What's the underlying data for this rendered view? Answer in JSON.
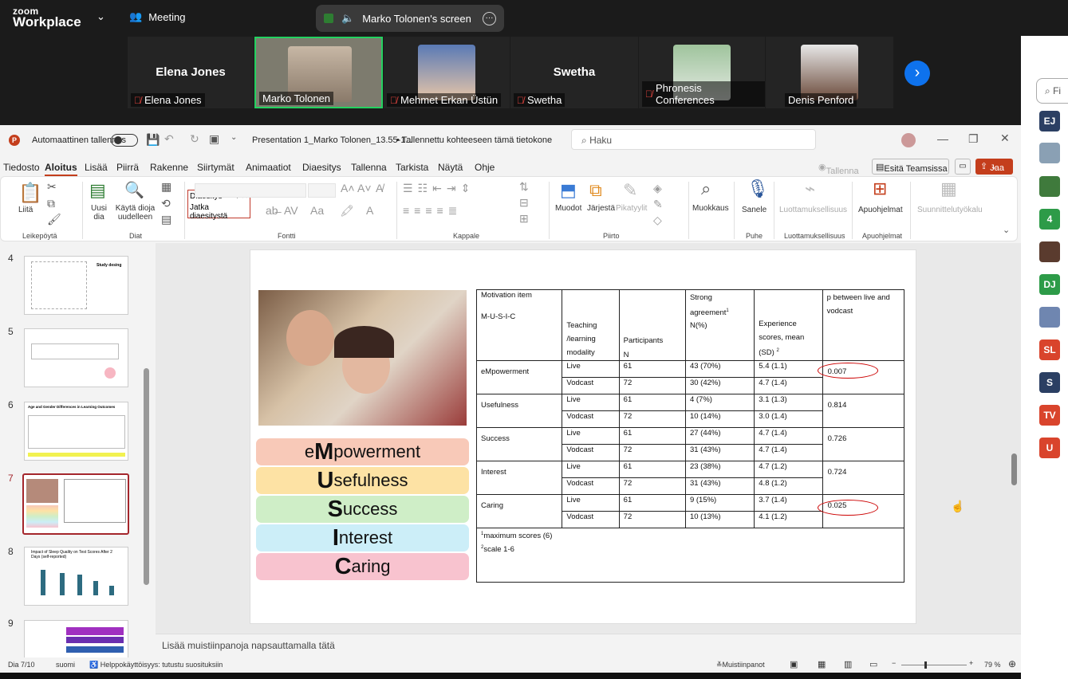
{
  "zoom": {
    "brand_top": "zoom",
    "brand_bottom": "Workplace",
    "meeting_label": "Meeting",
    "share_label": "Marko Tolonen's screen",
    "participants": [
      "Elena Jones",
      "Marko Tolonen",
      "Mehmet Erkan Üstün",
      "Swetha",
      "Phronesis Conferences",
      "Denis Penford"
    ],
    "tile_names": [
      "Elena Jones",
      "Swetha"
    ],
    "side_avatars": [
      "EJ",
      "4",
      "DJ",
      "SL",
      "S",
      "TV",
      "U"
    ],
    "side_search": "Fi"
  },
  "ppt": {
    "autosave": "Automaattinen tallennus",
    "doc_title": "Presentation 1_Marko Tolonen_13.55-1...",
    "saved": "• Tallennettu kohteeseen tämä tietokone",
    "search": "Haku",
    "menu": [
      "Tiedosto",
      "Aloitus",
      "Lisää",
      "Piirrä",
      "Rakenne",
      "Siirtymät",
      "Animaatiot",
      "Diaesitys",
      "Tallenna",
      "Tarkista",
      "Näytä",
      "Ohje"
    ],
    "record": "Tallenna",
    "present_teams": "Esitä Teamsissa",
    "share": "Jaa",
    "ribbon": {
      "paste": "Liitä",
      "new_slide": "Uusi dia",
      "reuse": "Käytä dioja uudelleen",
      "shapes": "Muodot",
      "arrange": "Järjestä",
      "quick": "Pikatyylit",
      "edit": "Muokkaus",
      "dictate": "Sanele",
      "sensitivity": "Luottamuksellisuus",
      "addins": "Apuohjelmat",
      "designer": "Suunnittelutyökalu",
      "groups": [
        "Leikepöytä",
        "Diat",
        "Fontti",
        "Kappale",
        "Piirto",
        "Puhe",
        "Luottamuksellisuus",
        "Apuohjelmat"
      ],
      "popup": [
        "Diaesitys",
        "Jatka diaesitystä"
      ]
    },
    "thumbs": {
      "numbers": [
        "4",
        "5",
        "6",
        "7",
        "8",
        "9"
      ],
      "t4_title": "Study desing",
      "t6_title": "Age and Gender Differences in Learning Outcomes",
      "t8_title": "Impact of Sleep Quality on Test Scores After 2 Days (self-reported)"
    },
    "notes": "Lisää muistiinpanoja napsauttamalla tätä",
    "status": {
      "slide": "Dia 7/10",
      "lang": "suomi",
      "access": "Helppokäyttöisyys: tutustu suosituksiin",
      "notes": "Muistiinpanot",
      "zoom": "79 %"
    }
  },
  "slide": {
    "bars": [
      {
        "big": "M",
        "pre": "e",
        "rest": "powerment",
        "color": "#f8c9b8"
      },
      {
        "big": "U",
        "pre": "",
        "rest": "sefulness",
        "color": "#fde2a4"
      },
      {
        "big": "S",
        "pre": "",
        "rest": "uccess",
        "color": "#cfeec7"
      },
      {
        "big": "I",
        "pre": "",
        "rest": "nterest",
        "color": "#cceef8"
      },
      {
        "big": "C",
        "pre": "",
        "rest": "aring",
        "color": "#f8c3cf"
      }
    ],
    "headers": {
      "item": "Motivation item",
      "musc": "M-U-S-I-C",
      "mod": "Teaching /learning modality",
      "part": "Participants",
      "n": "N",
      "agree": "Strong agreement",
      "agree_sup": "1",
      "nperc": "N(%)",
      "exp": "Experience scores, mean (SD)",
      "exp_sup": "2",
      "p": "p between live and vodcast"
    },
    "rows": [
      {
        "item": "eMpowerment",
        "p": "0.007",
        "live": [
          "Live",
          "61",
          "43 (70%)",
          "5.4 (1.1)"
        ],
        "vod": [
          "Vodcast",
          "72",
          "30 (42%)",
          "4.7 (1.4)"
        ]
      },
      {
        "item": "Usefulness",
        "p": "0.814",
        "live": [
          "Live",
          "61",
          "4 (7%)",
          "3.1 (1.3)"
        ],
        "vod": [
          "Vodcast",
          "72",
          "10 (14%)",
          "3.0 (1.4)"
        ]
      },
      {
        "item": "Success",
        "p": "0.726",
        "live": [
          "Live",
          "61",
          "27 (44%)",
          "4.7 (1.4)"
        ],
        "vod": [
          "Vodcast",
          "72",
          "31 (43%)",
          "4.7 (1.4)"
        ]
      },
      {
        "item": "Interest",
        "p": "0.724",
        "live": [
          "Live",
          "61",
          "23 (38%)",
          "4.7 (1.2)"
        ],
        "vod": [
          "Vodcast",
          "72",
          "31 (43%)",
          "4.8 (1.2)"
        ]
      },
      {
        "item": "Caring",
        "p": "0.025",
        "live": [
          "Live",
          "61",
          "9 (15%)",
          "3.7 (1.4)"
        ],
        "vod": [
          "Vodcast",
          "72",
          "10 (13%)",
          "4.1 (1.2)"
        ]
      }
    ],
    "foot1": "maximum scores (6)",
    "foot1_sup": "1",
    "foot2": "scale 1-6",
    "foot2_sup": "2"
  }
}
